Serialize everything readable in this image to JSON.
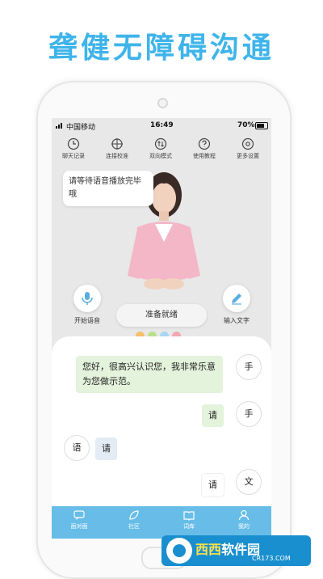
{
  "headline": "聋健无障碍沟通",
  "status": {
    "carrier": "中国移动",
    "time": "16:49",
    "battery": "70%"
  },
  "toolbar": [
    {
      "label": "聊天记录",
      "icon": "clock-icon"
    },
    {
      "label": "连接校准",
      "icon": "crosshair-icon"
    },
    {
      "label": "双向模式",
      "icon": "exchange-icon"
    },
    {
      "label": "使用教程",
      "icon": "help-icon"
    },
    {
      "label": "更多设置",
      "icon": "gear-icon"
    }
  ],
  "avatar_bubble": "请等待语音播放完毕哦",
  "controls": {
    "voice_label": "开始语音",
    "text_label": "输入文字",
    "ready_label": "准备就绪",
    "dot_colors": [
      "#f6c06a",
      "#b7e18a",
      "#a9d6f5",
      "#f3a7b0"
    ]
  },
  "chat": {
    "msg1": "您好，很高兴认识您，我非常乐意为您做示范。",
    "tag1": "手",
    "msg2": "请",
    "tag2": "手",
    "tag3": "语",
    "msg3": "请",
    "msg4": "请",
    "tag4": "文"
  },
  "tabs": [
    {
      "label": "面对面",
      "icon": "chat-icon"
    },
    {
      "label": "社区",
      "icon": "leaf-icon"
    },
    {
      "label": "词库",
      "icon": "book-icon"
    },
    {
      "label": "我的",
      "icon": "user-icon"
    }
  ],
  "watermark": {
    "brand_a": "西西",
    "brand_b": "软件园",
    "url": "CR173.COM"
  },
  "colors": {
    "accent": "#3fb4ea",
    "tabbar": "#67bde7"
  }
}
